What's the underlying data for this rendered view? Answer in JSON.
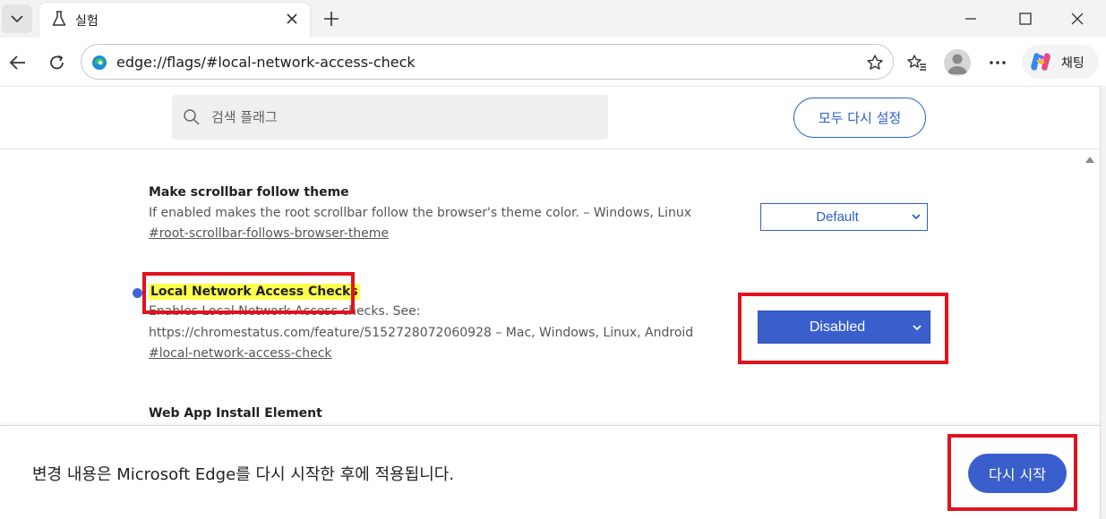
{
  "tab": {
    "title": "실험"
  },
  "address": {
    "url": "edge://flags/#local-network-access-check"
  },
  "copilot": {
    "label": "채팅"
  },
  "header": {
    "search_placeholder": "검색 플래그",
    "reset_label": "모두 다시 설정"
  },
  "flags": [
    {
      "title": "Make scrollbar follow theme",
      "description": "If enabled makes the root scrollbar follow the browser's theme color. – Windows, Linux",
      "link": "#root-scrollbar-follows-browser-theme",
      "value": "Default"
    },
    {
      "title": "Local Network Access Checks",
      "description_line1": "Enables Local Network Access checks. See:",
      "description_line2": "https://chromestatus.com/feature/5152728072060928 – Mac, Windows, Linux, Android",
      "link": "#local-network-access-check",
      "value": "Disabled"
    },
    {
      "title": "Web App Install Element"
    }
  ],
  "restart": {
    "message": "변경 내용은 Microsoft Edge를 다시 시작한 후에 적용됩니다.",
    "button": "다시 시작"
  },
  "colors": {
    "accent": "#3a5fcd",
    "link_blue": "#2b60c8",
    "highlight": "#ffff4d",
    "annotation_red": "#e0121e"
  }
}
